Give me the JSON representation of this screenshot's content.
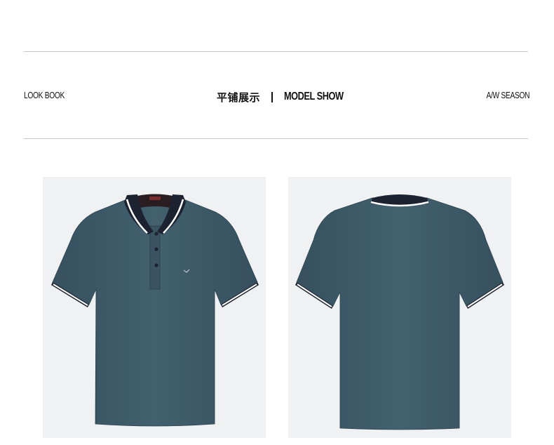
{
  "header": {
    "left_label": "LOOK BOOK",
    "title_cn": "平铺展示",
    "title_en": "MODEL SHOW",
    "right_label": "A/W SEASON"
  },
  "products": [
    {
      "view": "front",
      "shirt_color": "#3e5866",
      "collar_color": "#1c2230",
      "tip_color": "#ffffff"
    },
    {
      "view": "back",
      "shirt_color": "#3e5866",
      "collar_color": "#1c2230",
      "tip_color": "#ffffff"
    }
  ],
  "colors": {
    "panel_bg": "#f0f1f3",
    "rule": "#c8c8c8",
    "text": "#111111"
  }
}
